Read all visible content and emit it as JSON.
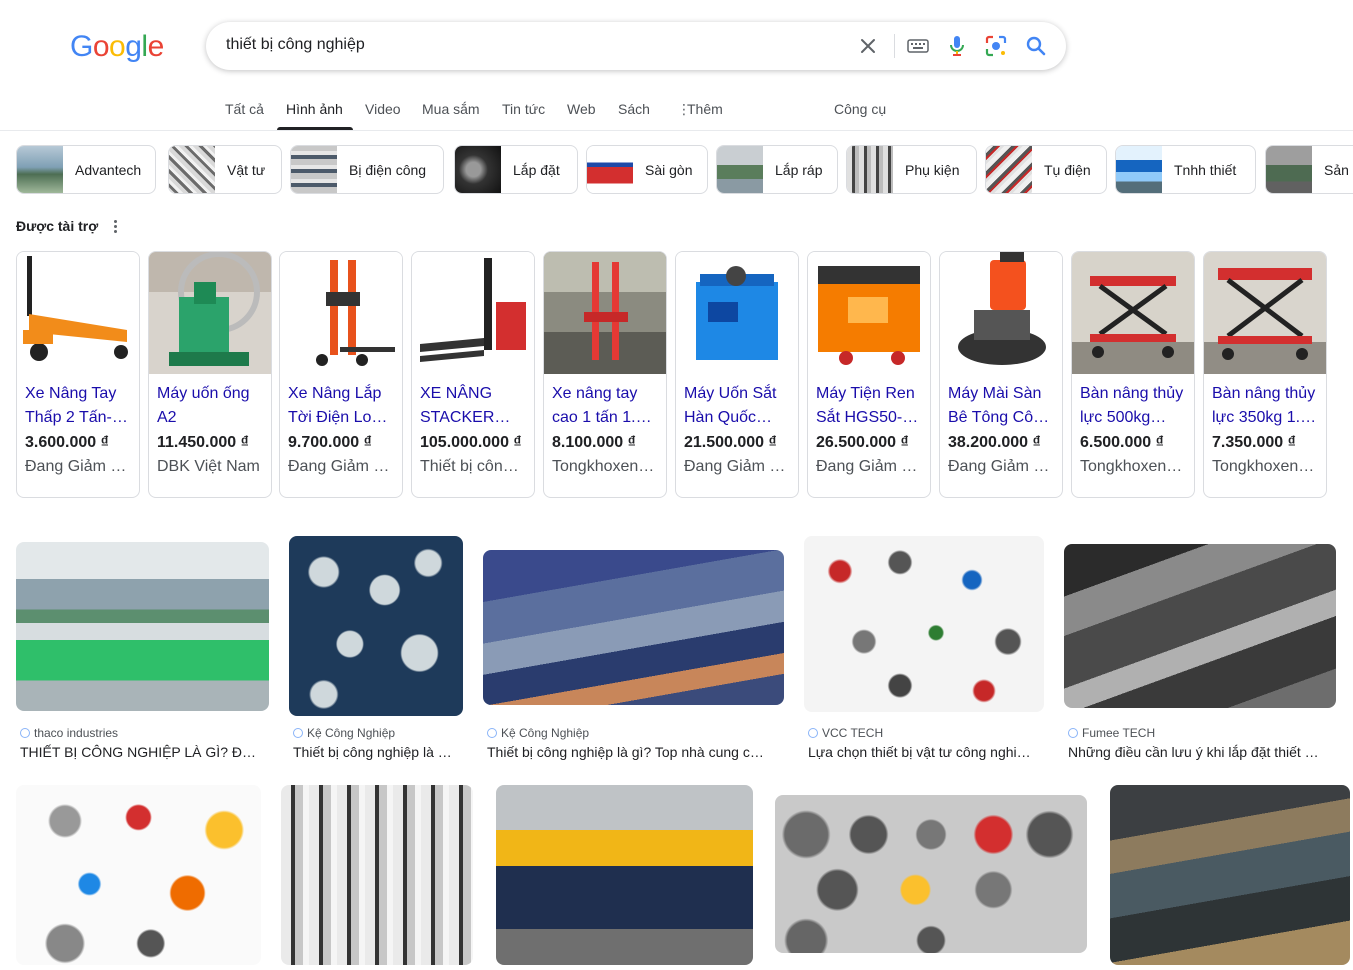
{
  "search": {
    "query": "thiết bị công nghiệp"
  },
  "logo": {
    "letters": [
      "G",
      "o",
      "o",
      "g",
      "l",
      "e"
    ],
    "colors": [
      "#4285F4",
      "#EA4335",
      "#FBBC05",
      "#4285F4",
      "#34A853",
      "#EA4335"
    ]
  },
  "tabs": [
    {
      "label": "Tất cả"
    },
    {
      "label": "Hình ảnh"
    },
    {
      "label": "Video"
    },
    {
      "label": "Mua sắm"
    },
    {
      "label": "Tin tức"
    },
    {
      "label": "Web"
    },
    {
      "label": "Sách"
    },
    {
      "label": "Thêm"
    },
    {
      "label": "Công cụ"
    }
  ],
  "chips": [
    {
      "label": "Advantech"
    },
    {
      "label": "Vật tư"
    },
    {
      "label": "Bị điện công"
    },
    {
      "label": "Lắp đặt"
    },
    {
      "label": "Sài gòn"
    },
    {
      "label": "Lắp ráp"
    },
    {
      "label": "Phụ kiện"
    },
    {
      "label": "Tụ điện"
    },
    {
      "label": "Tnhh thiết"
    },
    {
      "label": "Sản x"
    }
  ],
  "sponsored": {
    "label": "Được tài trợ",
    "products": [
      {
        "title": "Xe Nâng Tay Thấp 2 Tấn-…",
        "price": "3.600.000 ₫",
        "merchant": "Đang Giảm …"
      },
      {
        "title": "Máy uốn ống A2",
        "price": "11.450.000 ₫",
        "merchant": "DBK Việt Nam"
      },
      {
        "title": "Xe Nâng Lắp Tời Điện Lo…",
        "price": "9.700.000 ₫",
        "merchant": "Đang Giảm …"
      },
      {
        "title": "XE NÂNG STACKER…",
        "price": "105.000.000 ₫",
        "merchant": "Thiết bị côn…"
      },
      {
        "title": "Xe nâng tay cao 1 tấn 1.…",
        "price": "8.100.000 ₫",
        "merchant": "Tongkhoxen…"
      },
      {
        "title": "Máy Uốn Sắt Hàn Quốc…",
        "price": "21.500.000 ₫",
        "merchant": "Đang Giảm …"
      },
      {
        "title": "Máy Tiện Ren Sắt HGS50-…",
        "price": "26.500.000 ₫",
        "merchant": "Đang Giảm …"
      },
      {
        "title": "Máy Mài Sàn Bê Tông Cô…",
        "price": "38.200.000 ₫",
        "merchant": "Đang Giảm …"
      },
      {
        "title": "Bàn nâng thủy lực 500kg…",
        "price": "6.500.000 ₫",
        "merchant": "Tongkhoxen…"
      },
      {
        "title": "Bàn nâng thủy lực 350kg 1.…",
        "price": "7.350.000 ₫",
        "merchant": "Tongkhoxen…"
      }
    ]
  },
  "results": [
    {
      "source": "thaco industries",
      "title": "THIẾT BỊ CÔNG NGHIỆP LÀ GÌ? Đ…"
    },
    {
      "source": "Kệ Công Nghiệp",
      "title": "Thiết bị công nghiệp là …"
    },
    {
      "source": "Kệ Công Nghiệp",
      "title": "Thiết bị công nghiệp là gì? Top nhà cung c…"
    },
    {
      "source": "VCC TECH",
      "title": "Lựa chọn thiết bị vật tư công nghi…"
    },
    {
      "source": "Fumee TECH",
      "title": "Những điều cần lưu ý khi lắp đặt thiết …"
    }
  ]
}
